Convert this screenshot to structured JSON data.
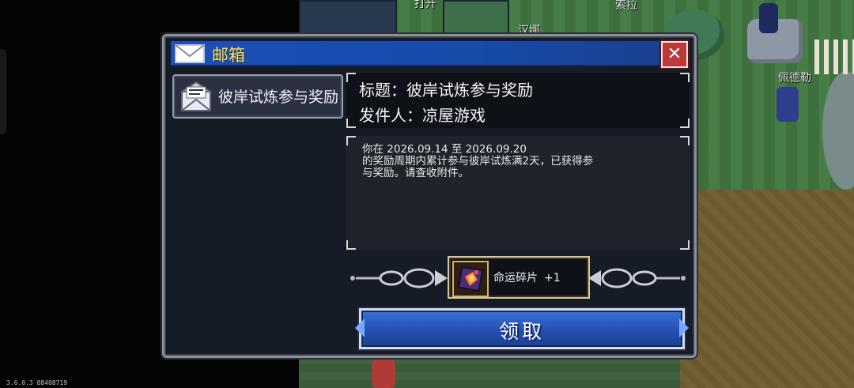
{
  "window": {
    "title": "邮箱",
    "close_icon": "close-icon"
  },
  "mail_list": [
    {
      "label": "彼岸试炼参与奖励",
      "icon": "opened-envelope-icon"
    }
  ],
  "mail": {
    "title_line": "标题：彼岸试炼参与奖励",
    "sender_line": "发件人：凉屋游戏",
    "body": "你在 2026.09.14 至 2026.09.20\n的奖励周期内累计参与彼岸试炼满2天，已获得参\n与奖励。请查收附件。"
  },
  "attachment": {
    "name": "命运碎片",
    "count": "+1",
    "icon": "fate-fragment-icon"
  },
  "claim_button": {
    "label": "领取"
  },
  "background": {
    "npc_labels": [
      "索拉",
      "佩德勒",
      "打开",
      "汉娜"
    ],
    "version": "3.6.0.3 88408719"
  },
  "colors": {
    "title_bar": "#1d4fb8",
    "title_text": "#ffe050",
    "close_button": "#c0383a",
    "claim_button": "#2450b2"
  }
}
